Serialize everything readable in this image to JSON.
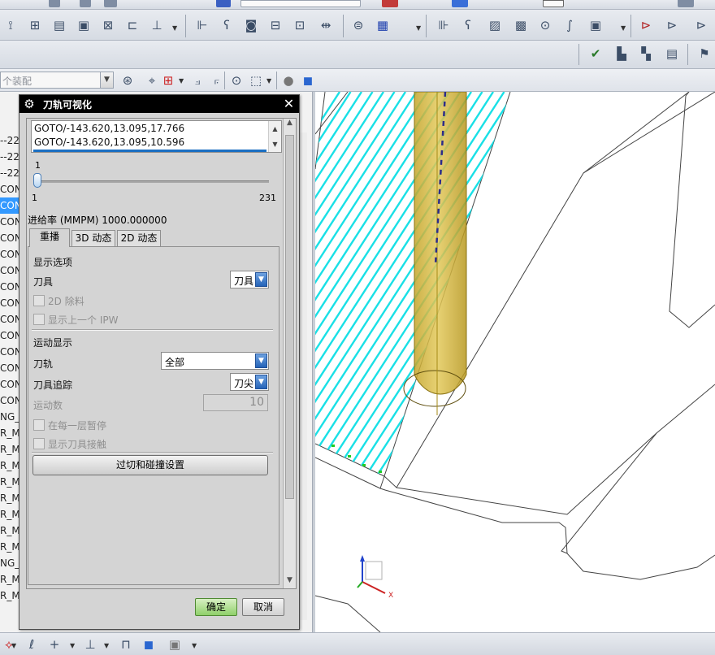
{
  "assembly_select": {
    "placeholder": "个装配"
  },
  "navigator": {
    "rows": [
      "--22",
      "--22",
      "--22",
      "CON",
      "CON",
      "CON",
      "CON",
      "CON",
      "CON",
      "CON",
      "CON",
      "CON",
      "CON",
      "CON",
      "CON",
      "CON",
      "CON",
      "NG_3",
      "R_MI",
      "R_MI",
      "R_MI",
      "R_MI",
      "R_MI",
      "R_MI",
      "R_MI",
      "R_MI",
      "NG_3",
      "R_MI",
      "R_MI"
    ],
    "selected_index": 4
  },
  "dialog": {
    "title": "刀轨可视化",
    "goto_lines": [
      "GOTO/-143.620,13.095,17.766",
      "GOTO/-143.620,13.095,10.596"
    ],
    "slider": {
      "current": "1",
      "min": "1",
      "max": "231",
      "fraction": 0.0
    },
    "feed_rate": "进给率 (MMPM) 1000.000000",
    "tabs": [
      "重播",
      "3D 动态",
      "2D 动态"
    ],
    "active_tab": 0,
    "display_options_group": "显示选项",
    "tool_label": "刀具",
    "tool_value": "刀具",
    "remove_2d_label": "2D 除料",
    "show_prev_ipw_label": "显示上一个 IPW",
    "motion_display_group": "运动显示",
    "toolpath_label": "刀轨",
    "toolpath_value": "全部",
    "tool_trace_label": "刀具追踪",
    "tool_trace_value": "刀尖",
    "motion_count_label": "运动数",
    "motion_count_value": "10",
    "pause_each_layer_label": "在每一层暂停",
    "show_tool_contact_label": "显示刀具接触",
    "gouge_button": "过切和碰撞设置",
    "ok_button": "确定",
    "cancel_button": "取消"
  },
  "viewport": {
    "triad": {
      "x_label": "X"
    },
    "colors": {
      "toolpath": "#19e0e6",
      "tool": "#d4b83a",
      "background": "#ffffff"
    }
  },
  "icons": [
    "gear-icon",
    "close-icon",
    "chevron-up-icon",
    "chevron-down-icon",
    "dropdown-arrow-icon"
  ]
}
